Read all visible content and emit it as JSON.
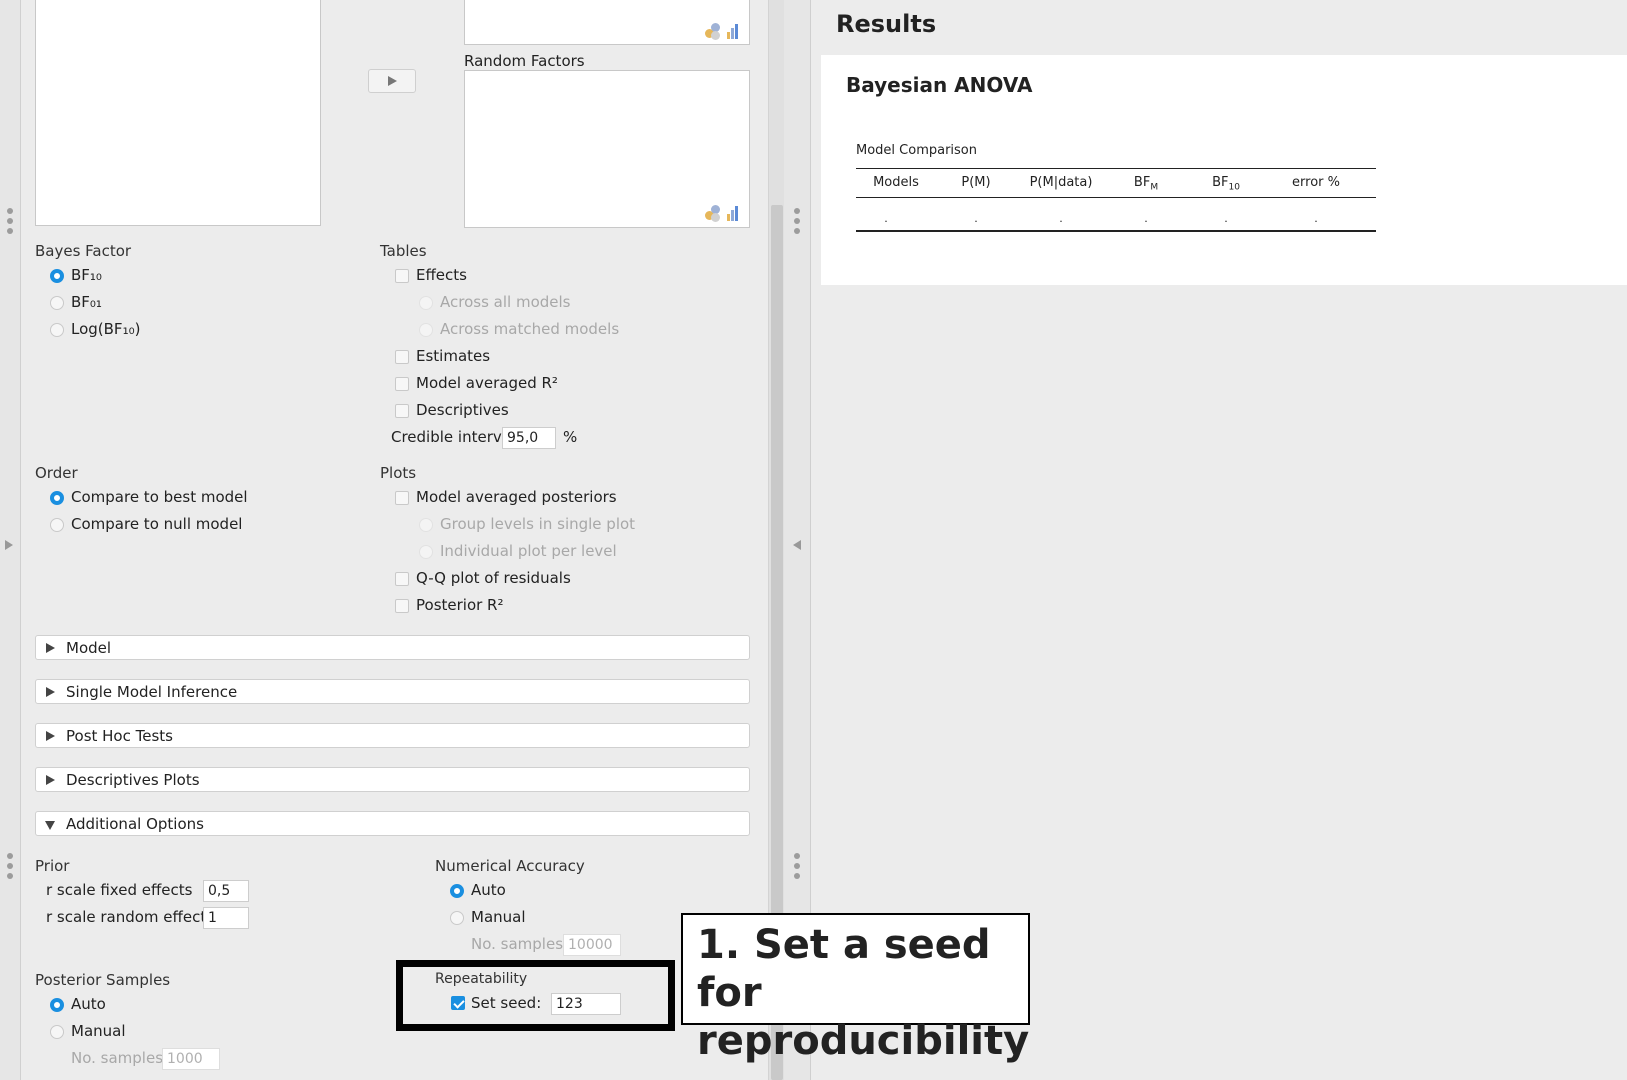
{
  "options": {
    "random_factors_label": "Random Factors",
    "bayes_factor": {
      "title": "Bayes Factor",
      "options": [
        "BF₁₀",
        "BF₀₁",
        "Log(BF₁₀)"
      ],
      "selected": 0
    },
    "tables": {
      "title": "Tables",
      "effects": "Effects",
      "across_all": "Across all models",
      "across_matched": "Across matched models",
      "estimates": "Estimates",
      "model_avg_r2": "Model averaged R²",
      "descriptives": "Descriptives",
      "credible_interval_label": "Credible interval",
      "credible_interval_value": "95,0",
      "percent": "%"
    },
    "order": {
      "title": "Order",
      "options": [
        "Compare to best model",
        "Compare to null model"
      ],
      "selected": 0
    },
    "plots": {
      "title": "Plots",
      "model_avg_posteriors": "Model averaged posteriors",
      "group_levels": "Group levels in single plot",
      "individual_plot": "Individual plot per level",
      "qq_plot": "Q-Q plot of residuals",
      "posterior_r2": "Posterior R²"
    },
    "sections": [
      "Model",
      "Single Model Inference",
      "Post Hoc Tests",
      "Descriptives Plots",
      "Additional Options"
    ],
    "prior": {
      "title": "Prior",
      "r_fixed_label": "r scale fixed effects",
      "r_fixed_value": "0,5",
      "r_random_label": "r scale random effects",
      "r_random_value": "1"
    },
    "numerical_accuracy": {
      "title": "Numerical Accuracy",
      "auto": "Auto",
      "manual": "Manual",
      "samples_label": "No. samples",
      "samples_value": "10000"
    },
    "posterior_samples": {
      "title": "Posterior Samples",
      "auto": "Auto",
      "manual": "Manual",
      "samples_label": "No. samples",
      "samples_value": "1000"
    },
    "repeatability": {
      "title": "Repeatability",
      "set_seed_label": "Set seed:",
      "seed_value": "123",
      "checked": true
    }
  },
  "results": {
    "title": "Results",
    "analysis_title": "Bayesian ANOVA",
    "table_caption": "Model Comparison",
    "columns": [
      "Models",
      "P(M)",
      "P(M|data)",
      "BF",
      "BF",
      "error %"
    ],
    "column_subscripts": [
      "",
      "",
      "",
      "M",
      "10",
      ""
    ],
    "row": [
      ".",
      ".",
      ".",
      ".",
      ".",
      "."
    ]
  },
  "annotation": {
    "line1": "1. Set a seed for",
    "line2": "reproducibility"
  },
  "colors": {
    "accent": "#1a8fe0",
    "panel_bg": "#ececec",
    "card_bg": "#ffffff"
  }
}
